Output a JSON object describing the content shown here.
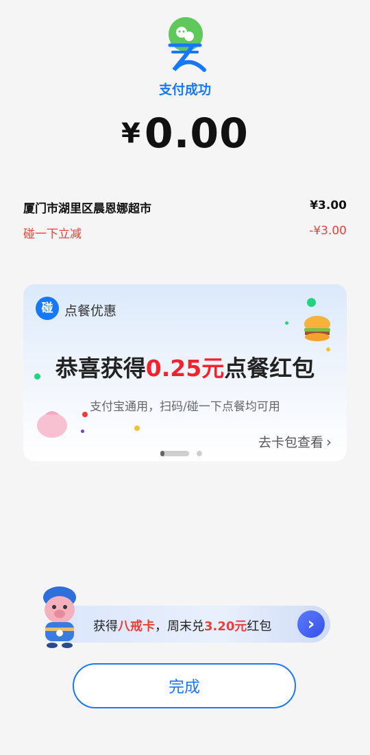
{
  "status": {
    "text": "支付成功"
  },
  "payment": {
    "currency_symbol": "¥",
    "amount": "0.00"
  },
  "items": [
    {
      "label": "厦门市湖里区晨恩娜超市",
      "price": "¥3.00"
    },
    {
      "label": "碰一下立减",
      "price": "-¥3.00"
    }
  ],
  "promo_card": {
    "badge": "碰",
    "label": "点餐优惠",
    "headline_prefix": "恭喜获得",
    "headline_amount": "0.25元",
    "headline_suffix": "点餐红包",
    "subtext": "支付宝通用，扫码/碰一下点餐均可用",
    "link_text": "去卡包查看",
    "pager": {
      "current": 1,
      "total": 2
    }
  },
  "banner": {
    "text_prefix": "获得",
    "text_card": "八戒卡",
    "text_mid": "，周末兑",
    "text_amount": "3.20元",
    "text_suffix": "红包"
  },
  "done_button": {
    "label": "完成"
  },
  "colors": {
    "accent": "#1677ff",
    "discount": "#e5413a",
    "highlight": "#f5222d"
  },
  "icons": {
    "logo": "alipay-success-logo-icon",
    "chevron": "chevron-right-icon",
    "arrow": "arrow-right-icon"
  }
}
